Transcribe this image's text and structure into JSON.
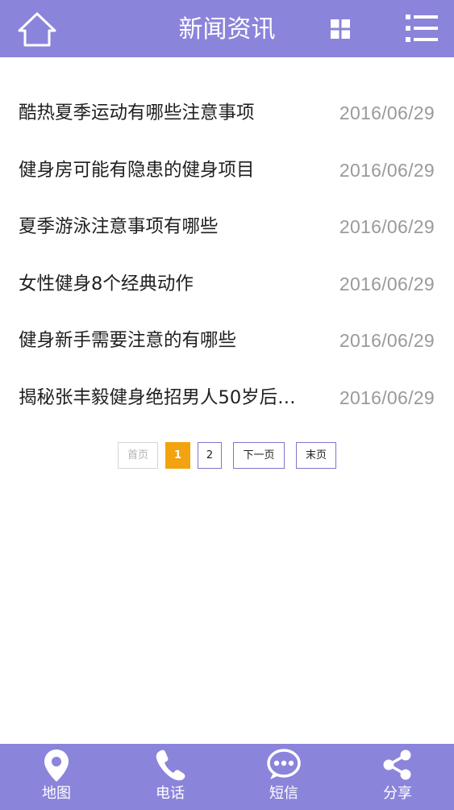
{
  "header": {
    "title": "新闻资讯",
    "home_icon": "home-icon",
    "grid_icon": "grid-icon",
    "menu_icon": "list-menu-icon",
    "bg_color": "#8b84db"
  },
  "news": [
    {
      "title": "酷热夏季运动有哪些注意事项",
      "date": "2016/06/29"
    },
    {
      "title": "健身房可能有隐患的健身项目",
      "date": "2016/06/29"
    },
    {
      "title": "夏季游泳注意事项有哪些",
      "date": "2016/06/29"
    },
    {
      "title": "女性健身8个经典动作",
      "date": "2016/06/29"
    },
    {
      "title": "健身新手需要注意的有哪些",
      "date": "2016/06/29"
    },
    {
      "title": "揭秘张丰毅健身绝招男人50岁后…",
      "date": "2016/06/29"
    }
  ],
  "pagination": {
    "first": "首页",
    "current": "1",
    "page2": "2",
    "next": "下一页",
    "last": "末页",
    "current_color": "#f2a30f"
  },
  "bottom_bar": {
    "tabs": [
      {
        "label": "地图",
        "icon": "map-pin-icon"
      },
      {
        "label": "电话",
        "icon": "phone-icon"
      },
      {
        "label": "短信",
        "icon": "sms-icon"
      },
      {
        "label": "分享",
        "icon": "share-icon"
      }
    ]
  }
}
